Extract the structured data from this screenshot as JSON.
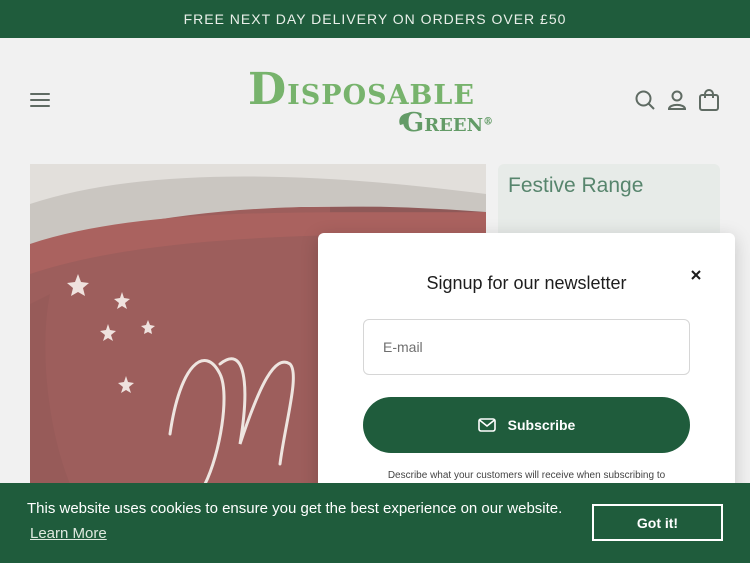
{
  "announcement": {
    "text": "FREE NEXT DAY DELIVERY ON ORDERS OVER £50"
  },
  "header": {
    "logo": {
      "line1_initial": "D",
      "line1_rest": "ISPOSABLE",
      "line2_initial": "G",
      "line2_rest": "REEN",
      "reg": "®"
    },
    "icons": [
      "menu-icon",
      "search-icon",
      "account-icon",
      "cart-icon"
    ]
  },
  "hero": {
    "image": "red-festive-cup-photo"
  },
  "festive": {
    "title": "Festive Range"
  },
  "newsletter": {
    "title": "Signup for our newsletter",
    "email_placeholder": "E-mail",
    "subscribe_label": "Subscribe",
    "description": "Describe what your customers will receive when subscribing to"
  },
  "cookie": {
    "message": "This website uses cookies to ensure you get the best experience on our website.",
    "learn_more": "Learn More",
    "accept": "Got it!"
  },
  "colors": {
    "brand_dark_green": "#1f5c3c",
    "logo_green": "#4a9a3b"
  }
}
